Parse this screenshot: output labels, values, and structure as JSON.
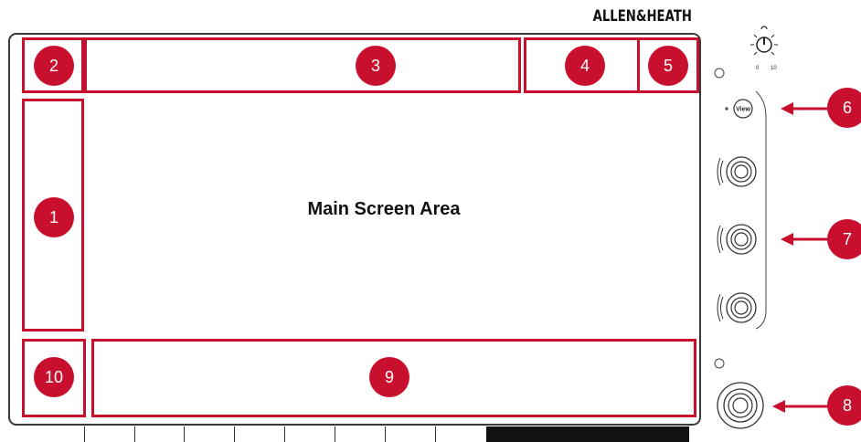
{
  "brand": "ALLEN&HEATH",
  "main_area": {
    "label": "Main Screen Area"
  },
  "regions": [
    {
      "id": "1",
      "label": "1"
    },
    {
      "id": "2",
      "label": "2"
    },
    {
      "id": "3",
      "label": "3"
    },
    {
      "id": "4",
      "label": "4"
    },
    {
      "id": "5",
      "label": "5"
    },
    {
      "id": "9",
      "label": "9"
    },
    {
      "id": "10",
      "label": "10"
    }
  ],
  "callouts": [
    {
      "id": "6",
      "label": "6"
    },
    {
      "id": "7",
      "label": "7"
    },
    {
      "id": "8",
      "label": "8"
    }
  ],
  "controls": {
    "view_button_label": "View",
    "headphone_min": "0",
    "headphone_max": "10"
  },
  "colors": {
    "accent": "#c8102e",
    "outline": "#3a3a3a"
  }
}
